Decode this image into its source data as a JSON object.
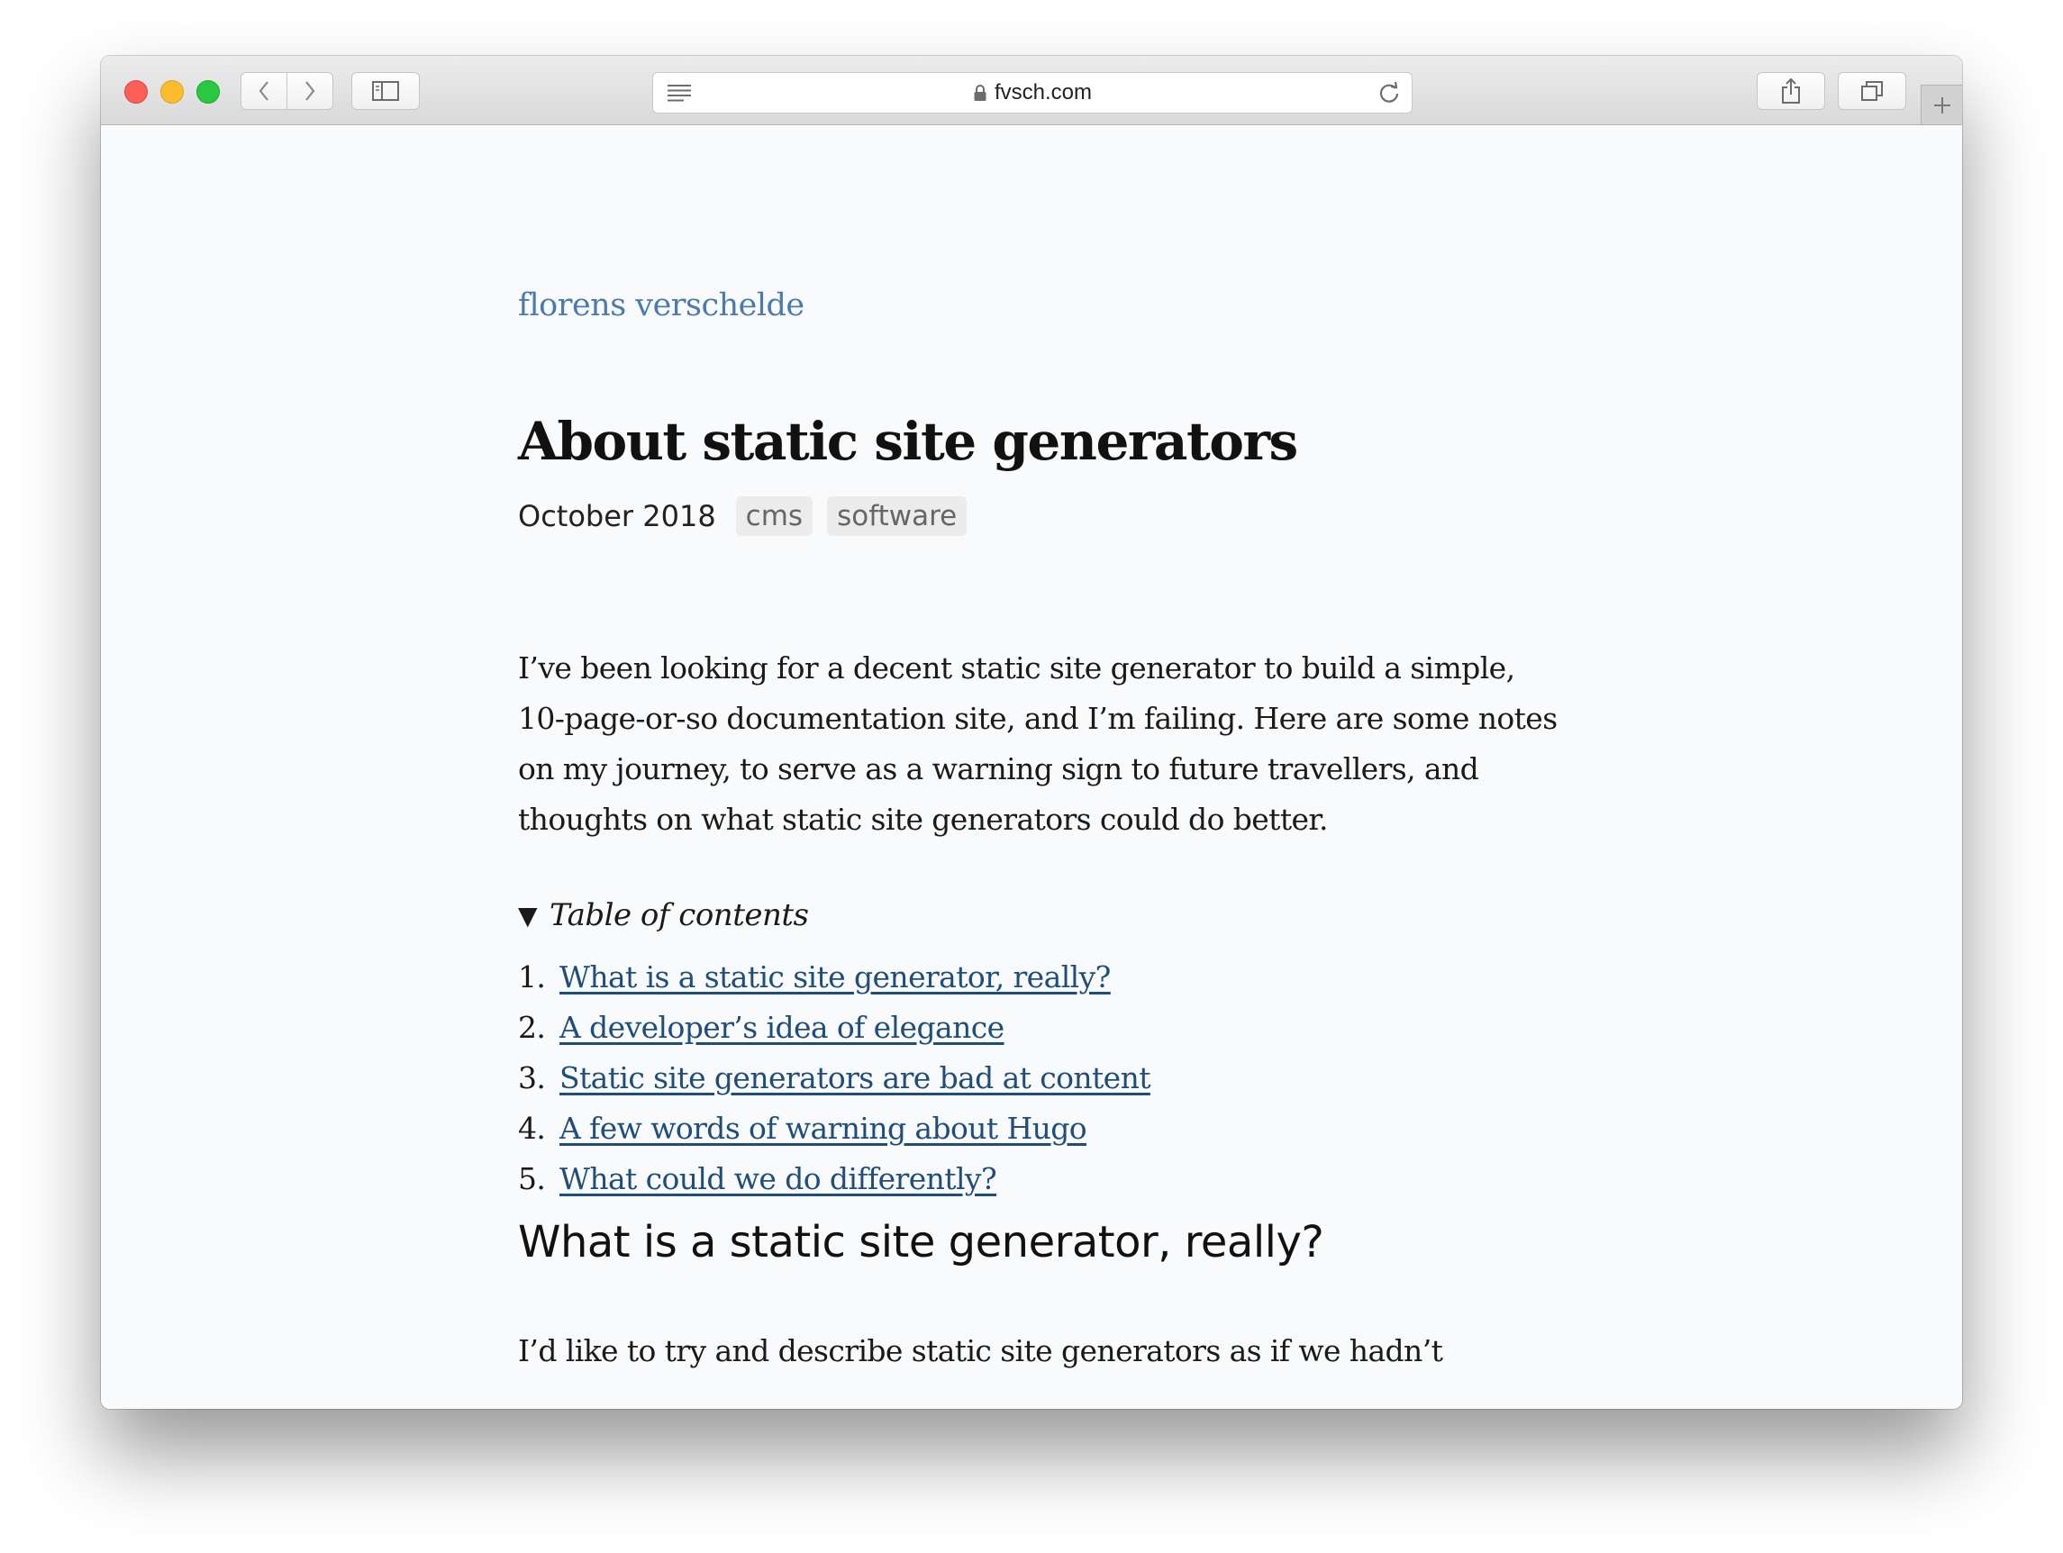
{
  "browser": {
    "url": "fvsch.com",
    "buttons": {
      "back": "back",
      "forward": "forward",
      "sidebar": "sidebar",
      "share": "share",
      "tabs": "tabs",
      "new_tab": "+"
    },
    "icons": [
      "chevron-left-icon",
      "chevron-right-icon",
      "sidebar-icon",
      "reader-icon",
      "lock-icon",
      "reload-icon",
      "share-icon",
      "tabs-icon",
      "plus-icon"
    ]
  },
  "site": {
    "name": "florens verschelde"
  },
  "post": {
    "title": "About static site generators",
    "date": "October 2018",
    "tags": [
      "cms",
      "software"
    ],
    "intro": "I’ve been looking for a decent static site generator to build a simple, 10-page-or-so documentation site, and I’m failing. Here are some notes on my journey, to serve as a warning sign to future travellers, and thoughts on what static site generators could do better.",
    "toc": {
      "summary": "Table of contents",
      "items": [
        {
          "num": "1.",
          "label": "What is a static site generator, really?"
        },
        {
          "num": "2.",
          "label": "A developer’s idea of elegance"
        },
        {
          "num": "3.",
          "label": "Static site generators are bad at content"
        },
        {
          "num": "4.",
          "label": "A few words of warning about Hugo"
        },
        {
          "num": "5.",
          "label": "What could we do differently?"
        }
      ]
    },
    "section1": {
      "heading": "What is a static site generator, really?",
      "para": "I’d like to try and describe static site generators as if we hadn’t"
    }
  },
  "colors": {
    "link": "#1f4e7a",
    "site_name": "#4a7ab0",
    "page_bg": "#f9fafb",
    "tag_bg": "#ececec"
  }
}
